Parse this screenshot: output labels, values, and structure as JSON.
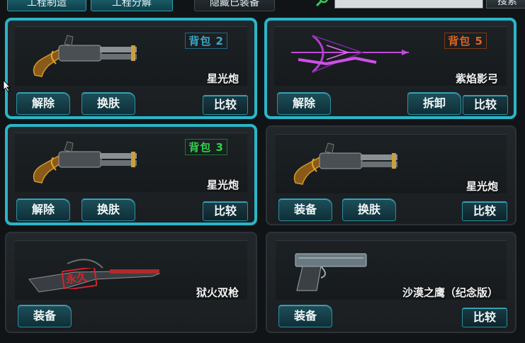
{
  "topbar": {
    "btn_left": "工程制造",
    "btn_mid": "工程分解",
    "btn_hide": "隐藏已装备",
    "search_label": "搜索",
    "search_icon": "search-icon"
  },
  "cards": [
    {
      "bag": "背包 2",
      "name": "星光炮",
      "b1": "解除",
      "b2": "换肤",
      "compare": "比较",
      "gun_icon": "starlight-cannon-icon"
    },
    {
      "bag": "背包 5",
      "name": "紫焰影弓",
      "b1": "解除",
      "b2": "拆卸",
      "compare": "比较",
      "gun_icon": "purple-bow-icon"
    },
    {
      "bag": "背包 3",
      "name": "星光炮",
      "b1": "解除",
      "b2": "换肤",
      "compare": "比较",
      "gun_icon": "starlight-cannon-icon"
    },
    {
      "name": "星光炮",
      "b1": "装备",
      "b2": "换肤",
      "compare": "比较",
      "gun_icon": "starlight-cannon-icon"
    },
    {
      "name": "狱火双枪",
      "b1": "装备",
      "stamp": "永久",
      "gun_icon": "hellfire-rifle-icon"
    },
    {
      "name": "沙漠之鹰（纪念版）",
      "b1": "装备",
      "compare": "比较",
      "gun_icon": "desert-eagle-icon"
    }
  ],
  "colors": {
    "selected_border": "#29b6c8",
    "bag_blue": "#3aa7c4",
    "bag_orange": "#e06420",
    "bag_green": "#2fd24a"
  }
}
